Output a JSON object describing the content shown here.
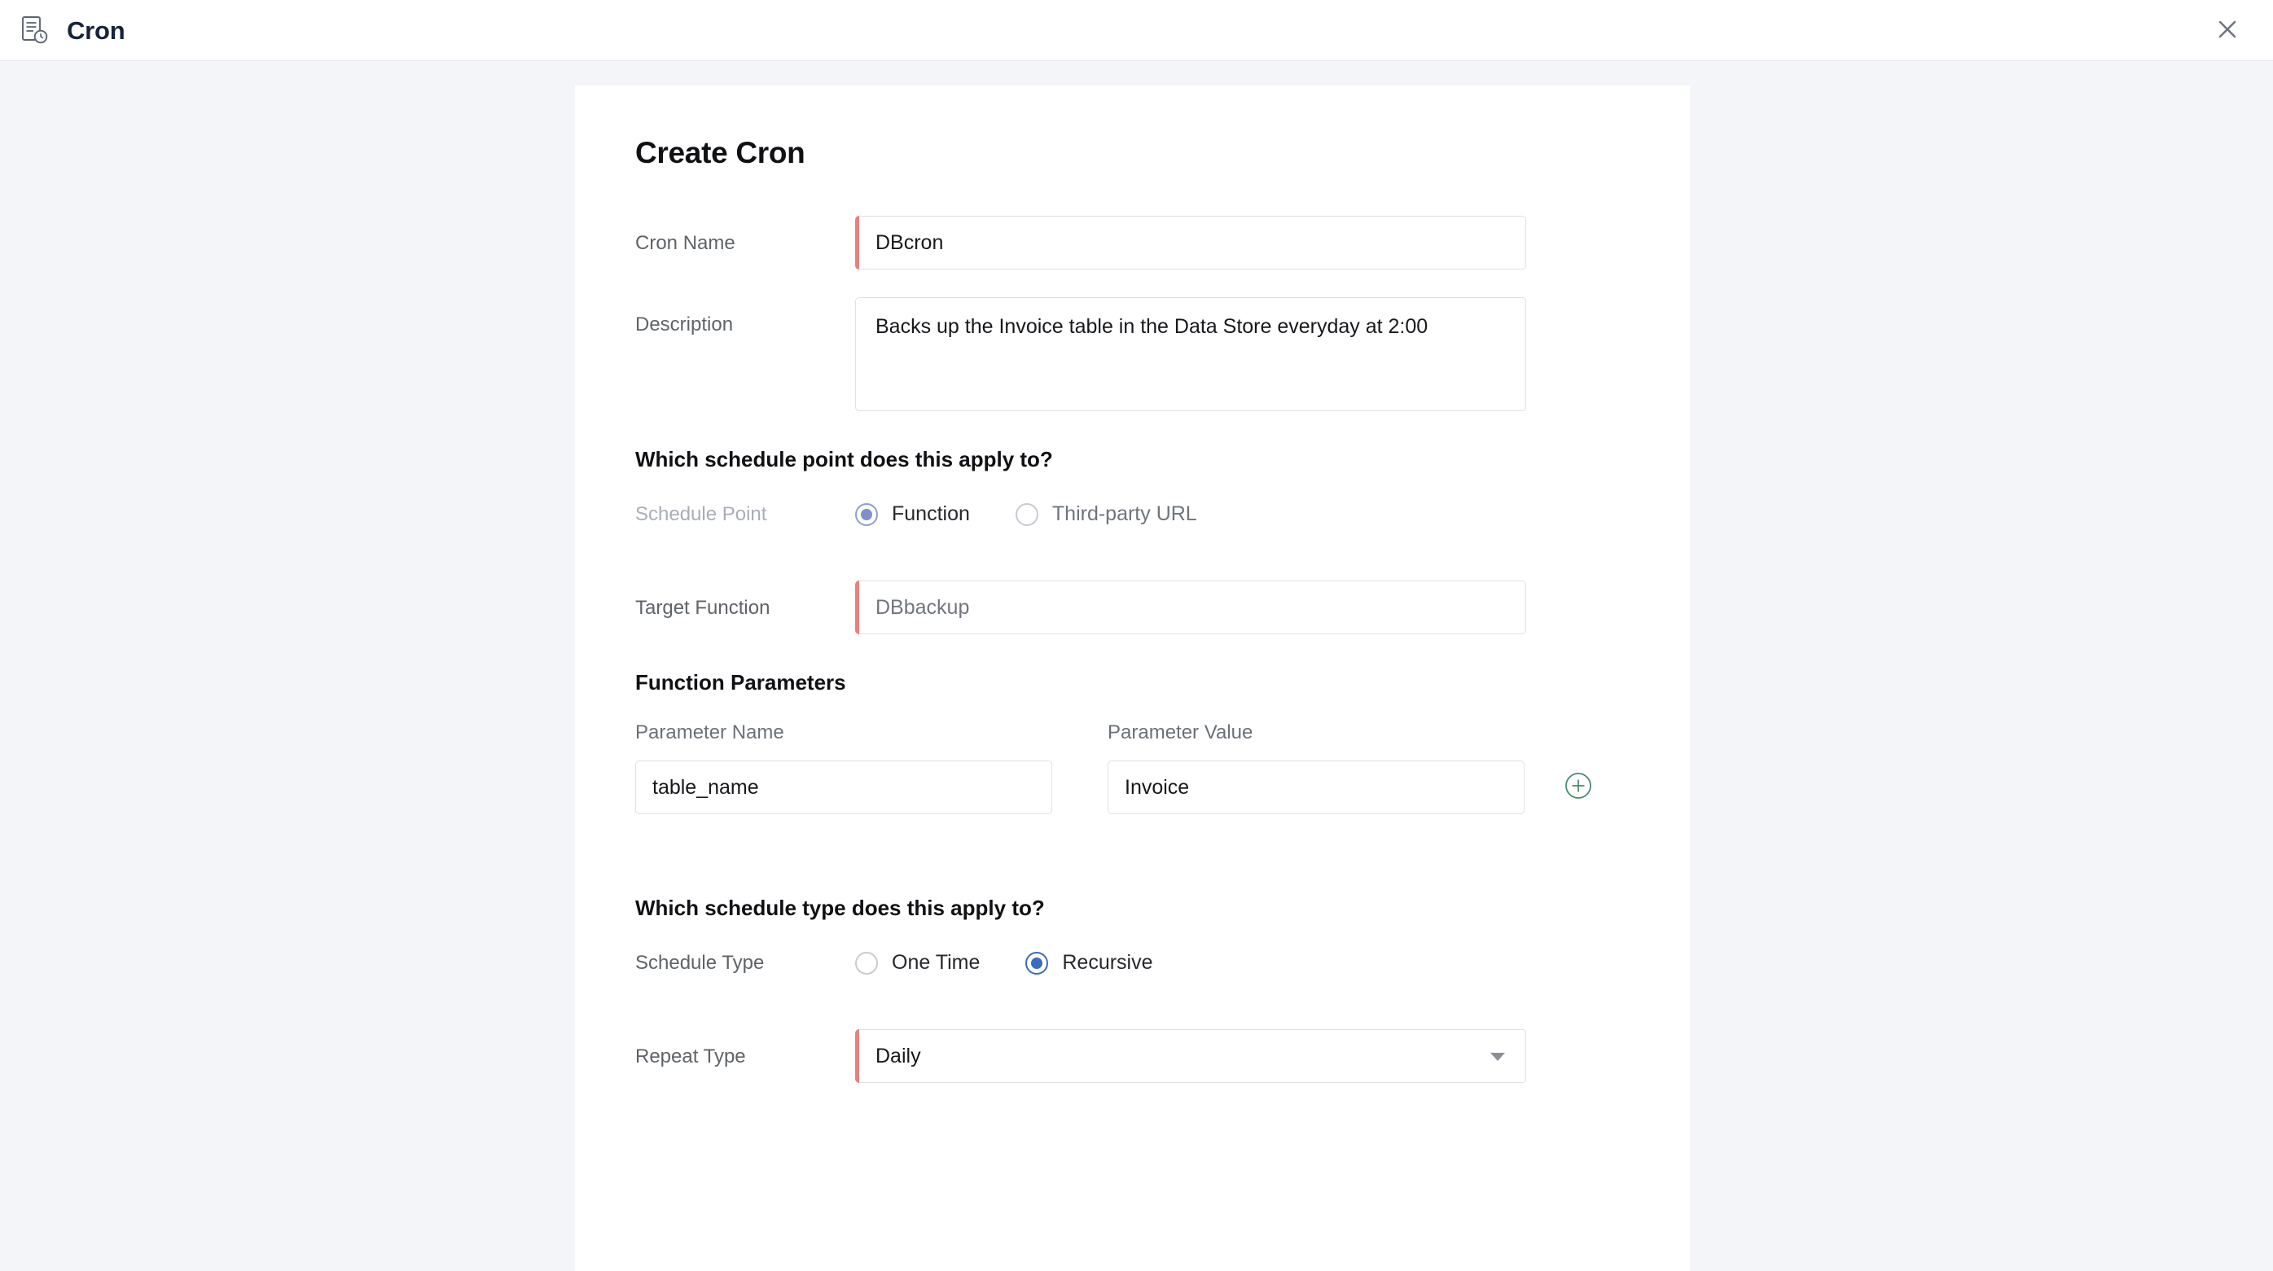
{
  "window": {
    "title": "Cron",
    "title_icon": "document-clock-icon",
    "close_icon": "close-icon"
  },
  "form": {
    "title": "Create Cron",
    "cron_name": {
      "label": "Cron Name",
      "value": "DBcron",
      "placeholder": "Cron Name",
      "required": true
    },
    "description": {
      "label": "Description",
      "value": "Backs up the Invoice table in the Data Store everyday at 2:00",
      "placeholder": "Description",
      "required": false
    },
    "schedule_point_section": {
      "heading": "Which schedule point does this apply to?",
      "label": "Schedule Point",
      "options": [
        {
          "label": "Function",
          "selected": true
        },
        {
          "label": "Third-party URL",
          "selected": false
        }
      ]
    },
    "target_function": {
      "label": "Target Function",
      "value": "DBbackup",
      "placeholder": "DBbackup",
      "required": true
    },
    "function_parameters": {
      "heading": "Function Parameters",
      "columns": [
        "Parameter Name",
        "Parameter Value"
      ],
      "rows": [
        {
          "name": "table_name",
          "value": "Invoice"
        }
      ],
      "add_icon": "plus-circle-icon"
    },
    "schedule_type_section": {
      "heading": "Which schedule type does this apply to?",
      "label": "Schedule Type",
      "options": [
        {
          "label": "One Time",
          "selected": false
        },
        {
          "label": "Recursive",
          "selected": true
        }
      ]
    },
    "repeat_type": {
      "label": "Repeat Type",
      "value": "Daily",
      "caret_icon": "chevron-down-icon",
      "required": true
    }
  },
  "colors": {
    "required_bar": "#e8817e",
    "radio_blue": "#3a6bbd",
    "radio_muted_blue": "#7d90c9",
    "add_green": "#4a8a6e",
    "page_bg": "#f4f5f8",
    "title_navy": "#17223b"
  }
}
